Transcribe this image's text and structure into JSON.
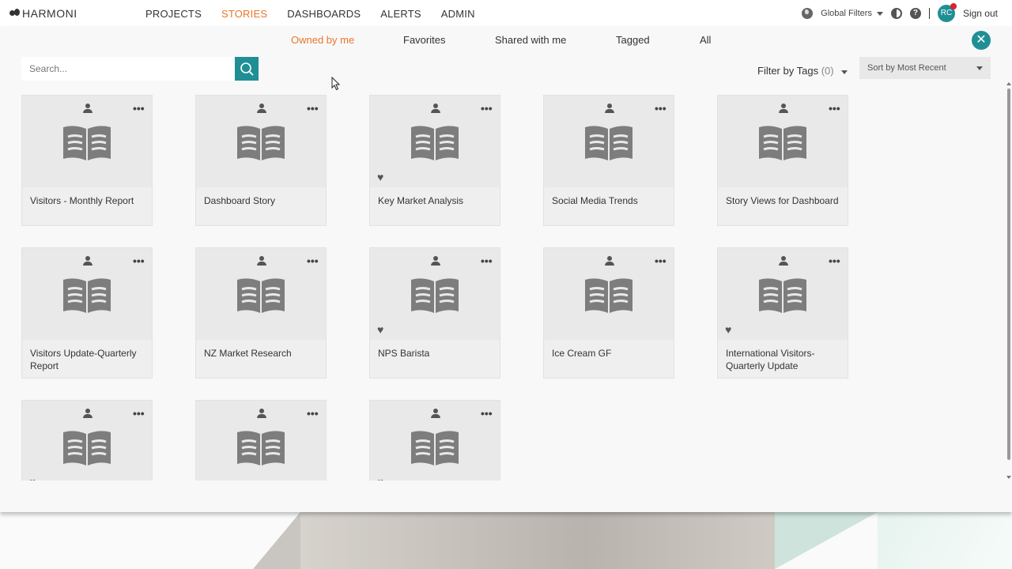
{
  "app": {
    "brand": "HARMONI"
  },
  "nav": {
    "items": [
      {
        "label": "PROJECTS",
        "active": false
      },
      {
        "label": "STORIES",
        "active": true
      },
      {
        "label": "DASHBOARDS",
        "active": false
      },
      {
        "label": "ALERTS",
        "active": false
      },
      {
        "label": "ADMIN",
        "active": false
      }
    ],
    "global_filters": "Global Filters",
    "user_initials": "RC",
    "sign_out": "Sign out"
  },
  "tabs": {
    "items": [
      {
        "label": "Owned by me",
        "active": true
      },
      {
        "label": "Favorites",
        "active": false
      },
      {
        "label": "Shared with me",
        "active": false
      },
      {
        "label": "Tagged",
        "active": false
      },
      {
        "label": "All",
        "active": false
      }
    ]
  },
  "search": {
    "placeholder": "Search..."
  },
  "filter": {
    "label": "Filter by Tags",
    "count": "(0)"
  },
  "sort": {
    "selected": "Sort by Most Recent"
  },
  "colors": {
    "accent": "#e9762b",
    "teal": "#1f8f95"
  },
  "stories": [
    {
      "title": "Visitors - Monthly Report",
      "favorite": false
    },
    {
      "title": "Dashboard Story",
      "favorite": false
    },
    {
      "title": "Key Market Analysis",
      "favorite": true
    },
    {
      "title": "Social Media Trends",
      "favorite": false
    },
    {
      "title": "Story Views for Dashboard",
      "favorite": false
    },
    {
      "title": "Visitors Update-Quarterly Report",
      "favorite": false
    },
    {
      "title": "NZ Market Research",
      "favorite": false
    },
    {
      "title": "NPS Barista",
      "favorite": true
    },
    {
      "title": "Ice Cream GF",
      "favorite": false
    },
    {
      "title": "International Visitors-Quarterly Update",
      "favorite": true
    },
    {
      "title": "",
      "favorite": true
    },
    {
      "title": "",
      "favorite": false
    },
    {
      "title": "",
      "favorite": true
    }
  ]
}
